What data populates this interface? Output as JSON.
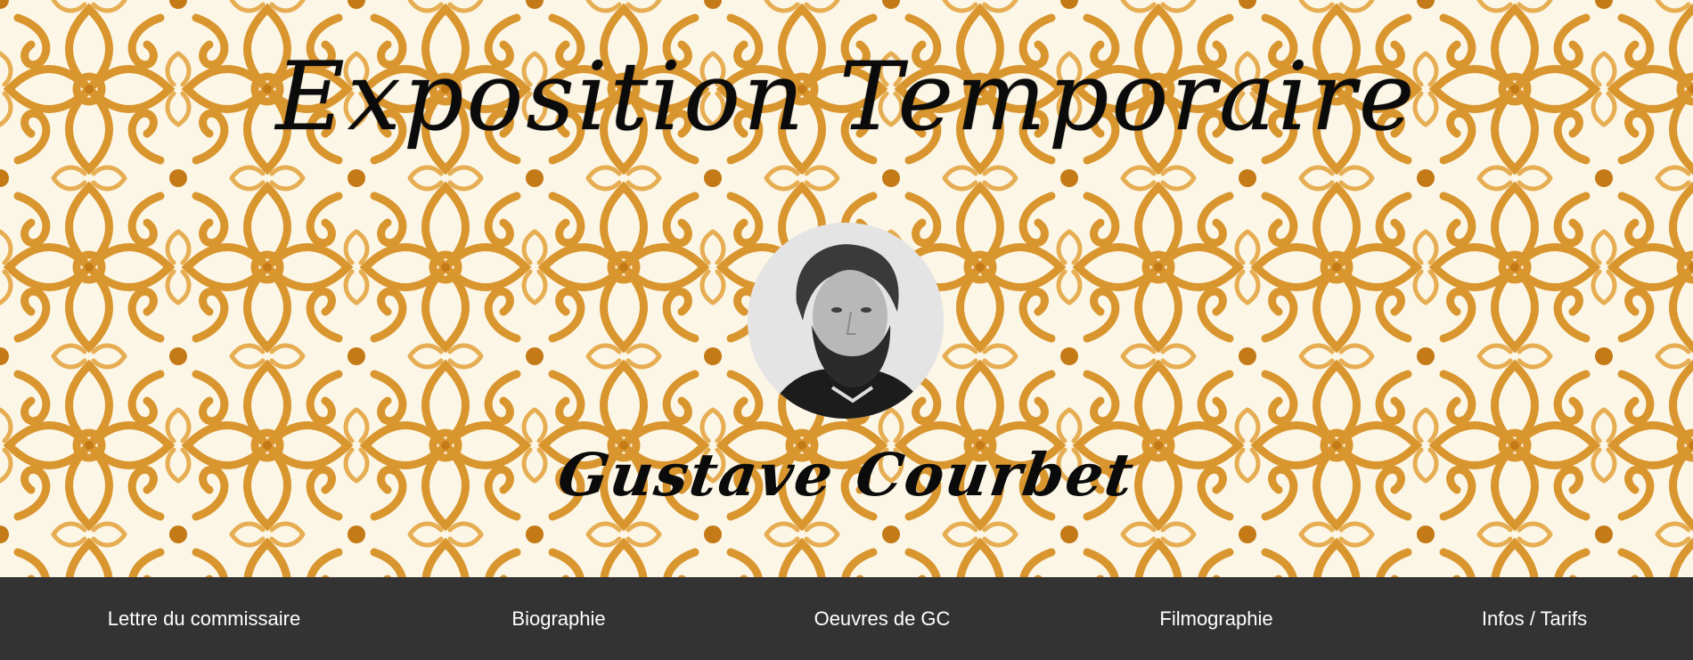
{
  "header": {
    "title": "Exposition Temporaire",
    "subtitle": "Gustave Courbet",
    "portrait_icon": "portrait-photo",
    "pattern_colors": {
      "base": "#fbf6e6",
      "ornament": "#d9952e",
      "ornament_dark": "#c47a16"
    }
  },
  "nav": {
    "background": "#333333",
    "items": [
      {
        "label": "Lettre du commissaire"
      },
      {
        "label": "Biographie"
      },
      {
        "label": "Oeuvres de GC"
      },
      {
        "label": "Filmographie"
      },
      {
        "label": "Infos / Tarifs"
      }
    ]
  }
}
